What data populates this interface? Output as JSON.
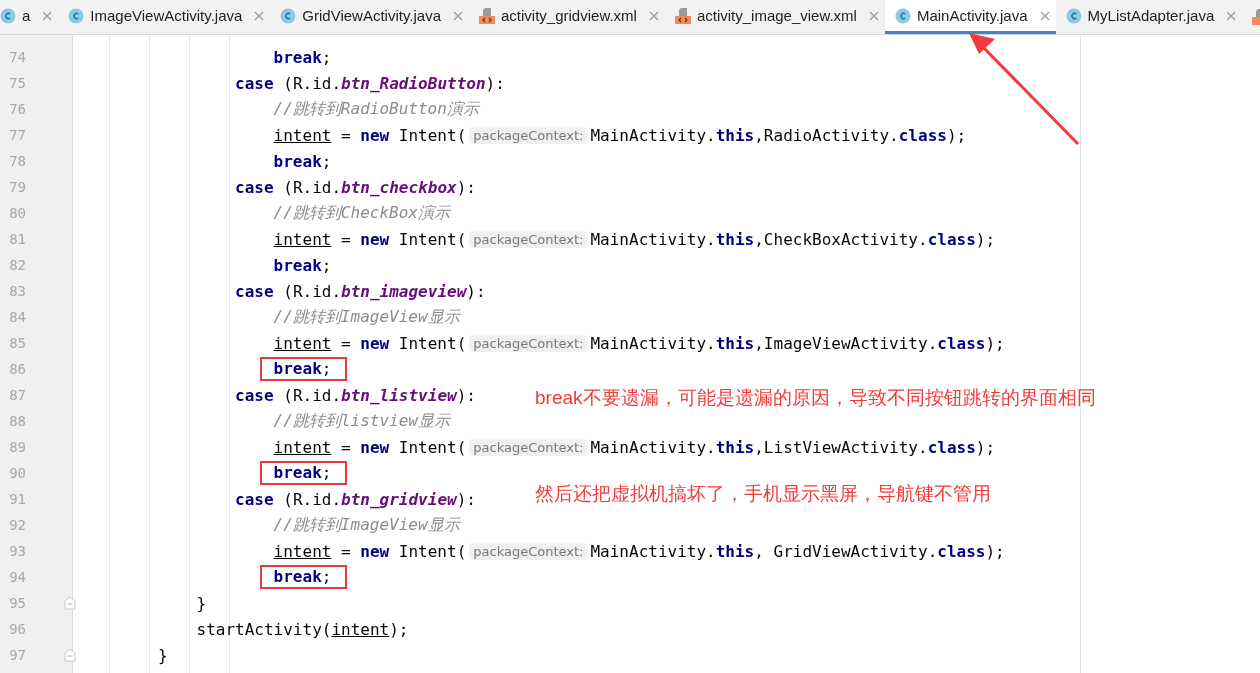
{
  "tabs": [
    {
      "label": "a",
      "kind": "java",
      "selected": false
    },
    {
      "label": "ImageViewActivity.java",
      "kind": "java",
      "selected": false
    },
    {
      "label": "GridViewActivity.java",
      "kind": "java",
      "selected": false
    },
    {
      "label": "activity_gridview.xml",
      "kind": "xml",
      "selected": false
    },
    {
      "label": "activity_image_view.xml",
      "kind": "xml",
      "selected": false
    },
    {
      "label": "MainActivity.java",
      "kind": "java",
      "selected": true
    },
    {
      "label": "MyListAdapter.java",
      "kind": "java",
      "selected": false
    }
  ],
  "code_lines": [
    {
      "number": "74",
      "kind": "body",
      "segments": [
        {
          "kind": "code",
          "boxed": false,
          "tokens": [
            {
              "kind": "kw",
              "text": "break"
            },
            {
              "kind": "plain",
              "text": ";"
            }
          ]
        }
      ]
    },
    {
      "number": "75",
      "kind": "case",
      "segments": [
        {
          "kind": "code",
          "boxed": false,
          "tokens": [
            {
              "kind": "kw",
              "text": "case"
            },
            {
              "kind": "plain",
              "text": " (R.id."
            },
            {
              "kind": "field",
              "text": "btn_RadioButton"
            },
            {
              "kind": "plain",
              "text": "):"
            }
          ]
        }
      ]
    },
    {
      "number": "76",
      "kind": "body",
      "segments": [
        {
          "kind": "code",
          "boxed": false,
          "tokens": [
            {
              "kind": "comment",
              "text": "//跳转到RadioButton演示"
            }
          ]
        }
      ]
    },
    {
      "number": "77",
      "kind": "body",
      "segments": [
        {
          "kind": "code",
          "boxed": false,
          "tokens": [
            {
              "kind": "var",
              "text": "intent"
            },
            {
              "kind": "plain",
              "text": " = "
            },
            {
              "kind": "kw",
              "text": "new"
            },
            {
              "kind": "plain",
              "text": " Intent("
            }
          ]
        },
        {
          "kind": "hint",
          "text": "packageContext:"
        },
        {
          "kind": "code",
          "boxed": false,
          "tokens": [
            {
              "kind": "plain",
              "text": "MainActivity."
            },
            {
              "kind": "kw",
              "text": "this"
            },
            {
              "kind": "plain",
              "text": ",RadioActivity."
            },
            {
              "kind": "kw",
              "text": "class"
            },
            {
              "kind": "plain",
              "text": ");"
            }
          ]
        }
      ]
    },
    {
      "number": "78",
      "kind": "body",
      "segments": [
        {
          "kind": "code",
          "boxed": false,
          "tokens": [
            {
              "kind": "kw",
              "text": "break"
            },
            {
              "kind": "plain",
              "text": ";"
            }
          ]
        }
      ]
    },
    {
      "number": "79",
      "kind": "case",
      "segments": [
        {
          "kind": "code",
          "boxed": false,
          "tokens": [
            {
              "kind": "kw",
              "text": "case"
            },
            {
              "kind": "plain",
              "text": " (R.id."
            },
            {
              "kind": "field",
              "text": "btn_checkbox"
            },
            {
              "kind": "plain",
              "text": "):"
            }
          ]
        }
      ]
    },
    {
      "number": "80",
      "kind": "body",
      "segments": [
        {
          "kind": "code",
          "boxed": false,
          "tokens": [
            {
              "kind": "comment",
              "text": "//跳转到CheckBox演示"
            }
          ]
        }
      ]
    },
    {
      "number": "81",
      "kind": "body",
      "segments": [
        {
          "kind": "code",
          "boxed": false,
          "tokens": [
            {
              "kind": "var",
              "text": "intent"
            },
            {
              "kind": "plain",
              "text": " = "
            },
            {
              "kind": "kw",
              "text": "new"
            },
            {
              "kind": "plain",
              "text": " Intent("
            }
          ]
        },
        {
          "kind": "hint",
          "text": "packageContext:"
        },
        {
          "kind": "code",
          "boxed": false,
          "tokens": [
            {
              "kind": "plain",
              "text": "MainActivity."
            },
            {
              "kind": "kw",
              "text": "this"
            },
            {
              "kind": "plain",
              "text": ",CheckBoxActivity."
            },
            {
              "kind": "kw",
              "text": "class"
            },
            {
              "kind": "plain",
              "text": ");"
            }
          ]
        }
      ]
    },
    {
      "number": "82",
      "kind": "body",
      "segments": [
        {
          "kind": "code",
          "boxed": false,
          "tokens": [
            {
              "kind": "kw",
              "text": "break"
            },
            {
              "kind": "plain",
              "text": ";"
            }
          ]
        }
      ]
    },
    {
      "number": "83",
      "kind": "case",
      "segments": [
        {
          "kind": "code",
          "boxed": false,
          "tokens": [
            {
              "kind": "kw",
              "text": "case"
            },
            {
              "kind": "plain",
              "text": " (R.id."
            },
            {
              "kind": "field",
              "text": "btn_imageview"
            },
            {
              "kind": "plain",
              "text": "):"
            }
          ]
        }
      ]
    },
    {
      "number": "84",
      "kind": "body",
      "segments": [
        {
          "kind": "code",
          "boxed": false,
          "tokens": [
            {
              "kind": "comment",
              "text": "//跳转到ImageView显示"
            }
          ]
        }
      ]
    },
    {
      "number": "85",
      "kind": "body",
      "segments": [
        {
          "kind": "code",
          "boxed": false,
          "tokens": [
            {
              "kind": "var",
              "text": "intent"
            },
            {
              "kind": "plain",
              "text": " = "
            },
            {
              "kind": "kw",
              "text": "new"
            },
            {
              "kind": "plain",
              "text": " Intent("
            }
          ]
        },
        {
          "kind": "hint",
          "text": "packageContext:"
        },
        {
          "kind": "code",
          "boxed": false,
          "tokens": [
            {
              "kind": "plain",
              "text": "MainActivity."
            },
            {
              "kind": "kw",
              "text": "this"
            },
            {
              "kind": "plain",
              "text": ",ImageViewActivity."
            },
            {
              "kind": "kw",
              "text": "class"
            },
            {
              "kind": "plain",
              "text": ");"
            }
          ]
        }
      ]
    },
    {
      "number": "86",
      "kind": "body",
      "segments": [
        {
          "kind": "code",
          "boxed": true,
          "tokens": [
            {
              "kind": "kw",
              "text": "break"
            },
            {
              "kind": "plain",
              "text": ";"
            }
          ]
        }
      ]
    },
    {
      "number": "87",
      "kind": "case",
      "segments": [
        {
          "kind": "code",
          "boxed": false,
          "tokens": [
            {
              "kind": "kw",
              "text": "case"
            },
            {
              "kind": "plain",
              "text": " (R.id."
            },
            {
              "kind": "field",
              "text": "btn_listview"
            },
            {
              "kind": "plain",
              "text": "):"
            }
          ]
        }
      ]
    },
    {
      "number": "88",
      "kind": "body",
      "segments": [
        {
          "kind": "code",
          "boxed": false,
          "tokens": [
            {
              "kind": "comment",
              "text": "//跳转到listview显示"
            }
          ]
        }
      ]
    },
    {
      "number": "89",
      "kind": "body",
      "segments": [
        {
          "kind": "code",
          "boxed": false,
          "tokens": [
            {
              "kind": "var",
              "text": "intent"
            },
            {
              "kind": "plain",
              "text": " = "
            },
            {
              "kind": "kw",
              "text": "new"
            },
            {
              "kind": "plain",
              "text": " Intent("
            }
          ]
        },
        {
          "kind": "hint",
          "text": "packageContext:"
        },
        {
          "kind": "code",
          "boxed": false,
          "tokens": [
            {
              "kind": "plain",
              "text": "MainActivity."
            },
            {
              "kind": "kw",
              "text": "this"
            },
            {
              "kind": "plain",
              "text": ",ListViewActivity."
            },
            {
              "kind": "kw",
              "text": "class"
            },
            {
              "kind": "plain",
              "text": ");"
            }
          ]
        }
      ]
    },
    {
      "number": "90",
      "kind": "body",
      "segments": [
        {
          "kind": "code",
          "boxed": true,
          "tokens": [
            {
              "kind": "kw",
              "text": "break"
            },
            {
              "kind": "plain",
              "text": ";"
            }
          ]
        }
      ]
    },
    {
      "number": "91",
      "kind": "case",
      "segments": [
        {
          "kind": "code",
          "boxed": false,
          "tokens": [
            {
              "kind": "kw",
              "text": "case"
            },
            {
              "kind": "plain",
              "text": " (R.id."
            },
            {
              "kind": "field",
              "text": "btn_gridview"
            },
            {
              "kind": "plain",
              "text": "):"
            }
          ]
        }
      ]
    },
    {
      "number": "92",
      "kind": "body",
      "segments": [
        {
          "kind": "code",
          "boxed": false,
          "tokens": [
            {
              "kind": "comment",
              "text": "//跳转到ImageView显示"
            }
          ]
        }
      ]
    },
    {
      "number": "93",
      "kind": "body",
      "segments": [
        {
          "kind": "code",
          "boxed": false,
          "tokens": [
            {
              "kind": "var",
              "text": "intent"
            },
            {
              "kind": "plain",
              "text": " = "
            },
            {
              "kind": "kw",
              "text": "new"
            },
            {
              "kind": "plain",
              "text": " Intent("
            }
          ]
        },
        {
          "kind": "hint",
          "text": "packageContext:"
        },
        {
          "kind": "code",
          "boxed": false,
          "tokens": [
            {
              "kind": "plain",
              "text": "MainActivity."
            },
            {
              "kind": "kw",
              "text": "this"
            },
            {
              "kind": "plain",
              "text": ", GridViewActivity."
            },
            {
              "kind": "kw",
              "text": "class"
            },
            {
              "kind": "plain",
              "text": ");"
            }
          ]
        }
      ]
    },
    {
      "number": "94",
      "kind": "body",
      "segments": [
        {
          "kind": "code",
          "boxed": true,
          "tokens": [
            {
              "kind": "kw",
              "text": "break"
            },
            {
              "kind": "plain",
              "text": ";"
            }
          ]
        }
      ]
    },
    {
      "number": "95",
      "kind": "switch_end",
      "fold": true,
      "segments": [
        {
          "kind": "code",
          "boxed": false,
          "tokens": [
            {
              "kind": "plain",
              "text": "}"
            }
          ]
        }
      ]
    },
    {
      "number": "96",
      "kind": "method_body",
      "segments": [
        {
          "kind": "code",
          "boxed": false,
          "tokens": [
            {
              "kind": "plain",
              "text": "startActivity("
            },
            {
              "kind": "var",
              "text": "intent"
            },
            {
              "kind": "plain",
              "text": ");"
            }
          ]
        }
      ]
    },
    {
      "number": "97",
      "kind": "method_end",
      "fold": true,
      "segments": [
        {
          "kind": "code",
          "boxed": false,
          "tokens": [
            {
              "kind": "plain",
              "text": "}"
            }
          ]
        }
      ]
    }
  ],
  "annotations": [
    {
      "kind": "note",
      "text": "break不要遗漏，可能是遗漏的原因，导致不同按钮跳转的界面相同"
    },
    {
      "kind": "note",
      "text": "然后还把虚拟机搞坏了，手机显示黑屏，导航键不管用"
    }
  ]
}
